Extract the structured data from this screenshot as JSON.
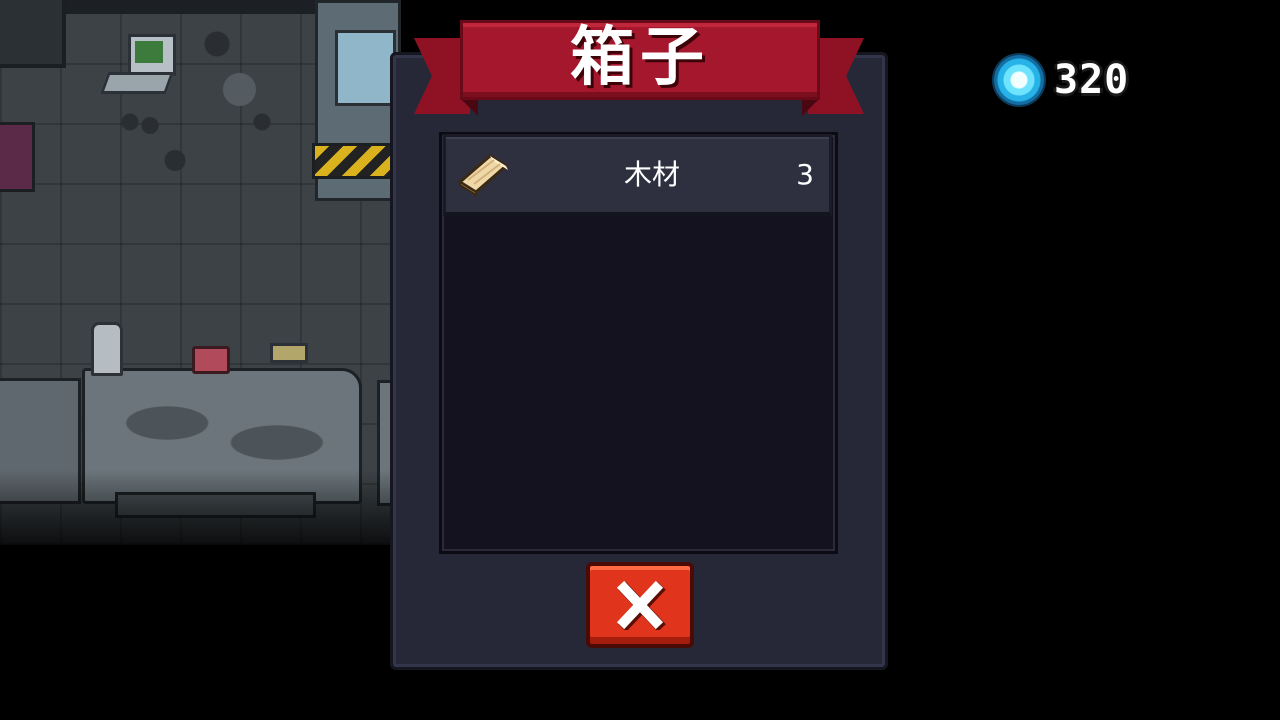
{
  "chest": {
    "title": "箱子",
    "items": [
      {
        "name": "木材",
        "count": "3",
        "icon": "wood-plank-icon"
      }
    ],
    "close_icon": "close-icon"
  },
  "hud": {
    "currency_icon": "gem-icon",
    "currency_value": "320"
  },
  "colors": {
    "ribbon": "#a4172d",
    "panel": "#262838",
    "close_button": "#e1341c",
    "gem": "#27b2e8"
  }
}
